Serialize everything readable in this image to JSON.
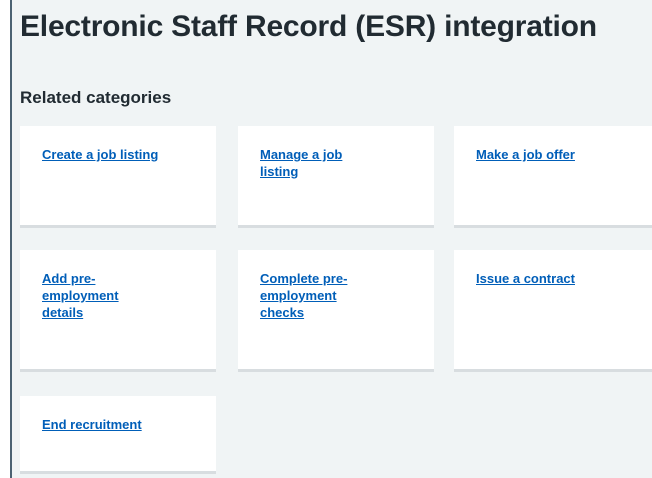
{
  "page": {
    "title": "Electronic Staff Record (ESR) integration"
  },
  "related": {
    "heading": "Related categories",
    "cards": [
      {
        "label": "Create a job listing"
      },
      {
        "label": "Manage a job listing"
      },
      {
        "label": "Make a job offer"
      },
      {
        "label": "Add pre-employment details"
      },
      {
        "label": "Complete pre-employment checks"
      },
      {
        "label": "Issue a contract"
      },
      {
        "label": "End recruitment"
      }
    ]
  },
  "colors": {
    "background": "#f0f4f5",
    "link": "#005eb8",
    "text": "#212b32",
    "card": "#ffffff",
    "card_shadow": "#d8dde0"
  }
}
